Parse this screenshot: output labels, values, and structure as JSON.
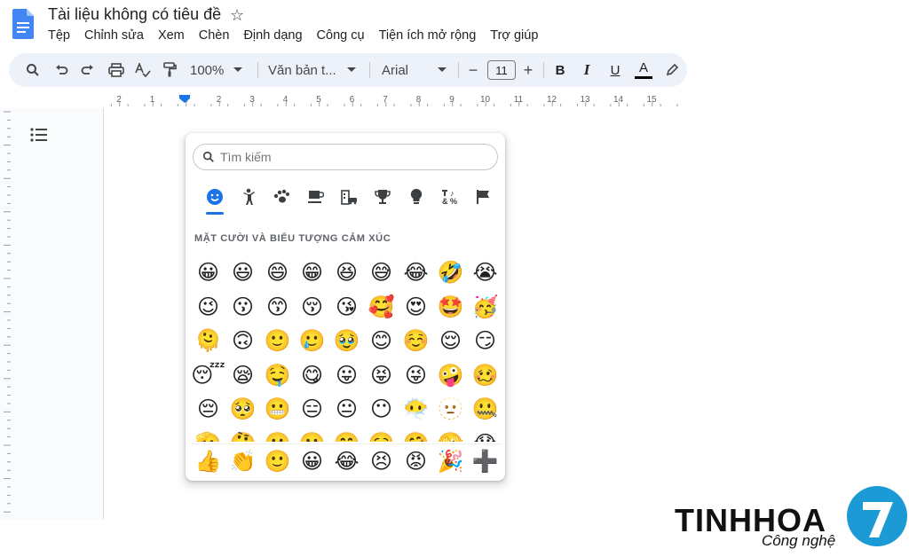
{
  "header": {
    "title": "Tài liệu không có tiêu đề",
    "menu": [
      "Tệp",
      "Chỉnh sửa",
      "Xem",
      "Chèn",
      "Định dạng",
      "Công cụ",
      "Tiện ích mở rộng",
      "Trợ giúp"
    ]
  },
  "toolbar": {
    "zoom": "100%",
    "style": "Văn bản t...",
    "font": "Arial",
    "font_size": "11",
    "bold": "B",
    "italic": "I",
    "underline": "U",
    "text_color": "A",
    "minus": "−",
    "plus": "+"
  },
  "ruler": {
    "labels": [
      "2",
      "1",
      "1",
      "2",
      "3",
      "4",
      "5",
      "6",
      "7",
      "8",
      "9",
      "10",
      "11",
      "12",
      "13",
      "14",
      "15"
    ]
  },
  "emoji_picker": {
    "search_placeholder": "Tìm kiếm",
    "categories": [
      "smileys-emotion",
      "people-body",
      "animals-nature",
      "food-drink",
      "travel-places",
      "activities",
      "objects",
      "symbols",
      "flags"
    ],
    "active_category": "smileys-emotion",
    "section_title": "MẶT CƯỜI VÀ BIỂU TƯỢNG CẢM XÚC",
    "emojis": [
      "😀",
      "😃",
      "😄",
      "😁",
      "😆",
      "😅",
      "😂",
      "🤣",
      "😭",
      "😉",
      "😗",
      "😙",
      "😚",
      "😘",
      "🥰",
      "😍",
      "🤩",
      "🥳",
      "🫠",
      "🙃",
      "🙂",
      "🥲",
      "🥹",
      "😊",
      "☺️",
      "😌",
      "😏",
      "😴",
      "😪",
      "🤤",
      "😋",
      "😛",
      "😝",
      "😜",
      "🤪",
      "🥴",
      "😔",
      "🥺",
      "😬",
      "😑",
      "😐",
      "😶",
      "😶‍🌫️",
      "🫥",
      "🤐",
      "🫡",
      "🤔",
      "🤫",
      "🫢",
      "🤭",
      "🥱",
      "🤗",
      "🫣",
      "😱"
    ],
    "recent": [
      "👍",
      "👏",
      "🙂",
      "😀",
      "😂",
      "😣",
      "😡",
      "🎉",
      "➕"
    ]
  },
  "logo": {
    "text": "TINHHOA",
    "sub": "Công nghệ",
    "mark": "7"
  },
  "colors": {
    "accent": "#1a73e8",
    "toolbar_bg": "#edf2fa",
    "logo_blue": "#1c9ad6"
  }
}
